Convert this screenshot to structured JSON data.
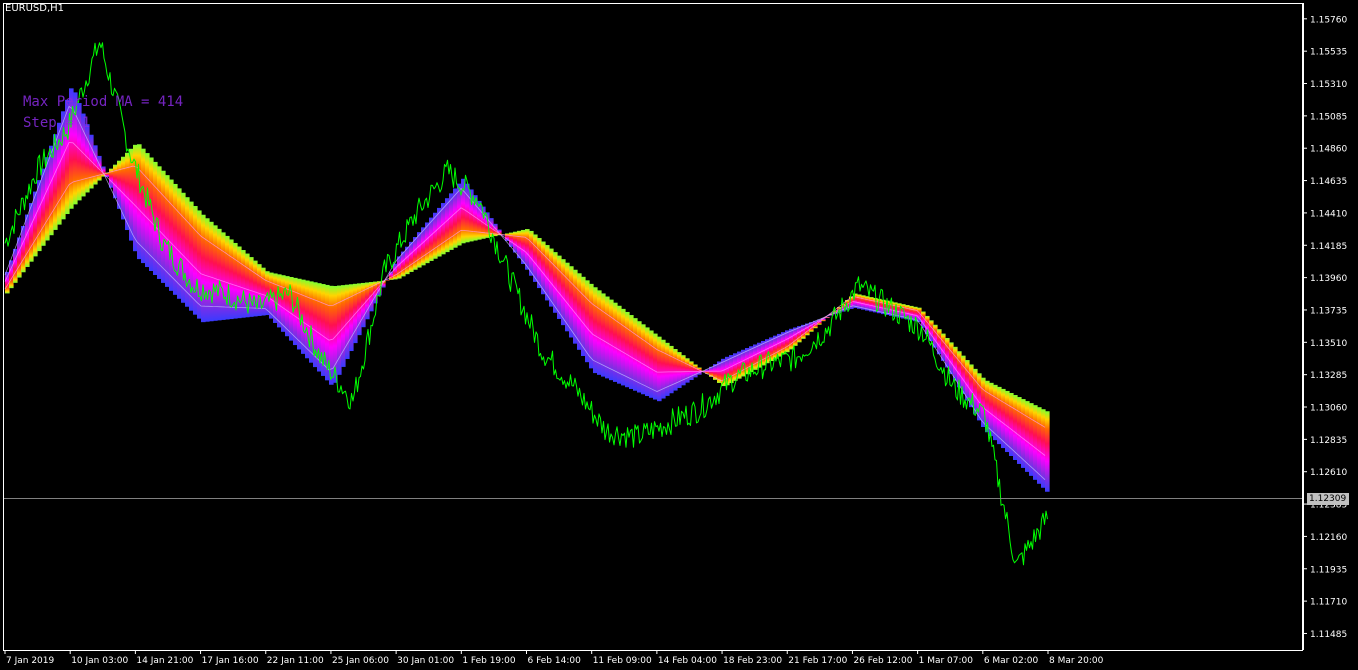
{
  "window": {
    "symbol_timeframe": "EURUSD,H1",
    "info_period": "Max Period MA = 414",
    "info_step": "Step = 1"
  },
  "current_price": "1.12309",
  "colors": {
    "background": "#000000",
    "price_line": "#00ff00",
    "axis": "#ffffff",
    "price_level_line": "#808080",
    "info_text": "#8a2be2"
  },
  "chart_data": {
    "type": "line",
    "title": "EURUSD,H1",
    "y_axis_side": "right",
    "ylim": [
      1.1137,
      1.1587
    ],
    "y_ticks": [
      "1.15760",
      "1.15535",
      "1.15310",
      "1.15085",
      "1.14860",
      "1.14635",
      "1.14410",
      "1.14185",
      "1.13960",
      "1.13735",
      "1.13510",
      "1.13285",
      "1.13060",
      "1.12835",
      "1.12610",
      "1.12385",
      "1.12160",
      "1.11935",
      "1.11710",
      "1.11485"
    ],
    "x_ticks": [
      "7 Jan 2019",
      "10 Jan 03:00",
      "14 Jan 21:00",
      "17 Jan 16:00",
      "22 Jan 11:00",
      "25 Jan 06:00",
      "30 Jan 01:00",
      "1 Feb 19:00",
      "6 Feb 14:00",
      "11 Feb 09:00",
      "14 Feb 04:00",
      "18 Feb 23:00",
      "21 Feb 17:00",
      "26 Feb 12:00",
      "1 Mar 07:00",
      "6 Mar 02:00",
      "8 Mar 20:00"
    ],
    "current_level": 1.12309,
    "series": [
      {
        "indicator": "rainbow moving-average ribbon (fast MA edge / slow MA edge)",
        "x": [
          "7 Jan 2019",
          "10 Jan 03:00",
          "14 Jan 21:00",
          "17 Jan 16:00",
          "22 Jan 11:00",
          "25 Jan 06:00",
          "30 Jan 01:00",
          "1 Feb 19:00",
          "6 Feb 14:00",
          "11 Feb 09:00",
          "14 Feb 04:00",
          "18 Feb 23:00",
          "21 Feb 17:00",
          "26 Feb 12:00",
          "1 Mar 07:00",
          "6 Mar 02:00",
          "8 Mar 20:00"
        ],
        "fast_edge": [
          1.14,
          1.153,
          1.141,
          1.1365,
          1.137,
          1.132,
          1.141,
          1.1465,
          1.14,
          1.133,
          1.131,
          1.134,
          1.136,
          1.1375,
          1.1365,
          1.129,
          1.1245
        ],
        "slow_edge": [
          1.1385,
          1.1445,
          1.149,
          1.144,
          1.14,
          1.139,
          1.1395,
          1.142,
          1.143,
          1.139,
          1.1355,
          1.132,
          1.1345,
          1.1385,
          1.1375,
          1.1325,
          1.1302
        ]
      },
      {
        "indicator": "price (close, H1)",
        "x": [
          "7 Jan 2019",
          "8 Jan 2019",
          "9 Jan 2019",
          "10 Jan 03:00",
          "11 Jan 2019",
          "14 Jan 21:00",
          "16 Jan 2019",
          "17 Jan 16:00",
          "21 Jan 2019",
          "22 Jan 11:00",
          "24 Jan 2019",
          "25 Jan 06:00",
          "28 Jan 2019",
          "30 Jan 01:00",
          "31 Jan 2019",
          "1 Feb 19:00",
          "5 Feb 2019",
          "6 Feb 14:00",
          "8 Feb 2019",
          "11 Feb 09:00",
          "13 Feb 2019",
          "14 Feb 04:00",
          "15 Feb 2019",
          "18 Feb 23:00",
          "20 Feb 2019",
          "21 Feb 17:00",
          "25 Feb 2019",
          "26 Feb 12:00",
          "28 Feb 2019",
          "1 Mar 07:00",
          "5 Mar 2019",
          "6 Mar 02:00",
          "7 Mar 2019",
          "8 Mar 20:00"
        ],
        "values": [
          1.142,
          1.147,
          1.15,
          1.156,
          1.148,
          1.142,
          1.139,
          1.1385,
          1.1375,
          1.1385,
          1.134,
          1.131,
          1.14,
          1.144,
          1.147,
          1.145,
          1.1395,
          1.1345,
          1.132,
          1.129,
          1.1285,
          1.1295,
          1.1305,
          1.1325,
          1.1335,
          1.134,
          1.136,
          1.139,
          1.1375,
          1.136,
          1.132,
          1.13,
          1.1195,
          1.123
        ]
      }
    ],
    "grid": false,
    "legend": "none"
  }
}
